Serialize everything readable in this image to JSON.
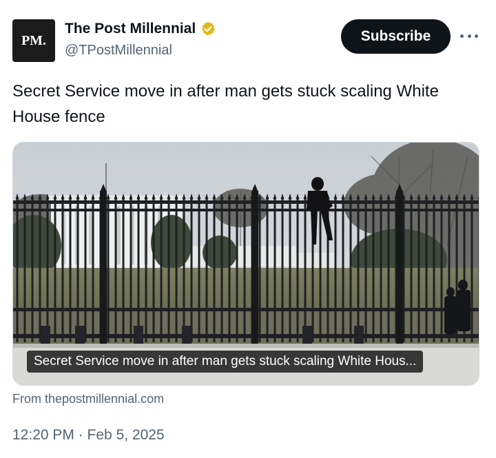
{
  "account": {
    "avatar_text": "PM.",
    "display_name": "The Post Millennial",
    "handle": "@TPostMillennial",
    "verified_badge_color": "#e2b719"
  },
  "actions": {
    "subscribe_label": "Subscribe",
    "more_icon": "more-horizontal-icon"
  },
  "tweet": {
    "text": "Secret Service move in after man gets stuck scaling White House fence"
  },
  "media": {
    "caption": "Secret Service move in after man gets stuck scaling White Hous..."
  },
  "card": {
    "source": "From thepostmillennial.com"
  },
  "meta": {
    "timestamp": "12:20 PM · Feb 5, 2025"
  },
  "colors": {
    "primary_text": "#0f1419",
    "secondary_text": "#536471",
    "button_bg": "#0f1419"
  }
}
